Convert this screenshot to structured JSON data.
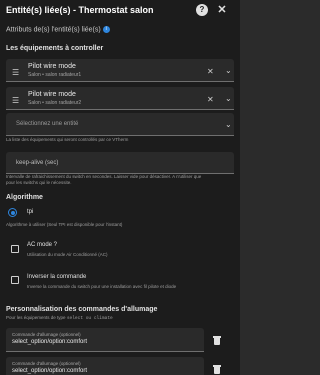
{
  "dialog": {
    "title": "Entité(s) liée(s) - Thermostat salon",
    "subtitle": "Attributs de(s) l'entité(s) liée(s)"
  },
  "equipment": {
    "heading": "Les équipements à controller",
    "entities": [
      {
        "name": "Pilot wire mode",
        "context": "Salon • salon radiateur1"
      },
      {
        "name": "Pilot wire mode",
        "context": "Salon • salon radiateur2"
      }
    ],
    "select_placeholder": "Sélectionnez une entité",
    "helper": "La liste des équipements qui seront controllés par ce VTherm"
  },
  "keep_alive": {
    "label": "keep-alive (sec)",
    "helper_line1": "Intervalle de rafraichissement du switch en secondes. Laisser vide pour désactiver. A n'utiliser que",
    "helper_line2": "pour les switchs qui le nécessite."
  },
  "algorithm": {
    "heading": "Algorithme",
    "option": "tpi",
    "helper": "Algorithme à utiliser (Seul TPI est disponible pour l'instant)"
  },
  "ac_mode": {
    "label": "AC mode ?",
    "helper": "Utilisation du mode Air Conditionné (AC)"
  },
  "invert": {
    "label": "Inverser la commande",
    "helper": "Inverse la commande du switch pour une installation avec fil pilote et diode"
  },
  "commands": {
    "heading": "Personnalisation des commandes d'allumage",
    "helper_prefix": "Pour les équipements de type",
    "helper_code": "select ou climate",
    "items": [
      {
        "label": "Commande d'allumage (optionnel)",
        "value": "select_option/option:comfort"
      },
      {
        "label": "Commande d'allumage (optionnel)",
        "value": "select_option/option:comfort"
      }
    ]
  }
}
